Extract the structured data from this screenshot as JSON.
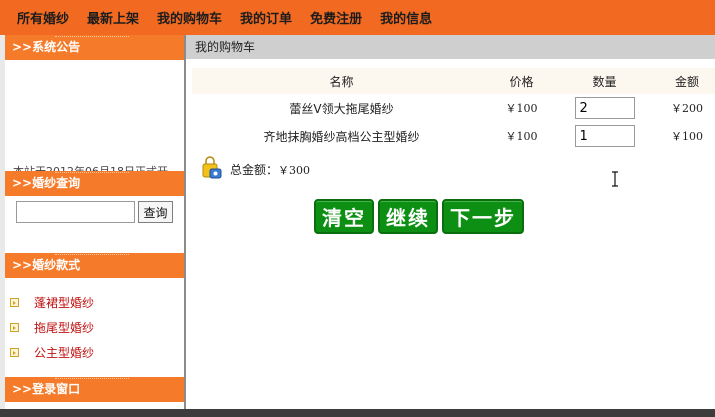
{
  "nav": {
    "items": [
      "所有婚纱",
      "最新上架",
      "我的购物车",
      "我的订单",
      "免费注册",
      "我的信息"
    ]
  },
  "sidebar": {
    "notice": {
      "title": ">>系统公告",
      "text": "本站于2012年06月18日正式开"
    },
    "search": {
      "title": ">>婚纱查询",
      "input_value": "",
      "button_label": "查询"
    },
    "styles": {
      "title": ">>婚纱款式",
      "items": [
        "蓬裙型婚纱",
        "拖尾型婚纱",
        "公主型婚纱"
      ]
    },
    "login": {
      "title": ">>登录窗口"
    }
  },
  "main": {
    "title": "我的购物车",
    "table": {
      "headers": [
        "名称",
        "价格",
        "数量",
        "金额"
      ],
      "rows": [
        {
          "name": "蕾丝V领大拖尾婚纱",
          "price": "￥100",
          "qty": "2",
          "amount": "￥200"
        },
        {
          "name": "齐地抹胸婚纱高档公主型婚纱",
          "price": "￥100",
          "qty": "1",
          "amount": "￥100"
        }
      ]
    },
    "total": {
      "label": "总金额：",
      "value": "￥300"
    },
    "buttons": {
      "clear": "清空",
      "continue": "继续",
      "next": "下一步"
    }
  },
  "icons": {
    "total": "shopping-bag-icon",
    "bullet": "arrow-bullet-icon",
    "cursor": "text-cursor-icon"
  },
  "colors": {
    "nav_bg": "#f26a21",
    "panel_header": "#f57b2a",
    "button_green": "#0c8f12",
    "link_red": "#c01010"
  }
}
